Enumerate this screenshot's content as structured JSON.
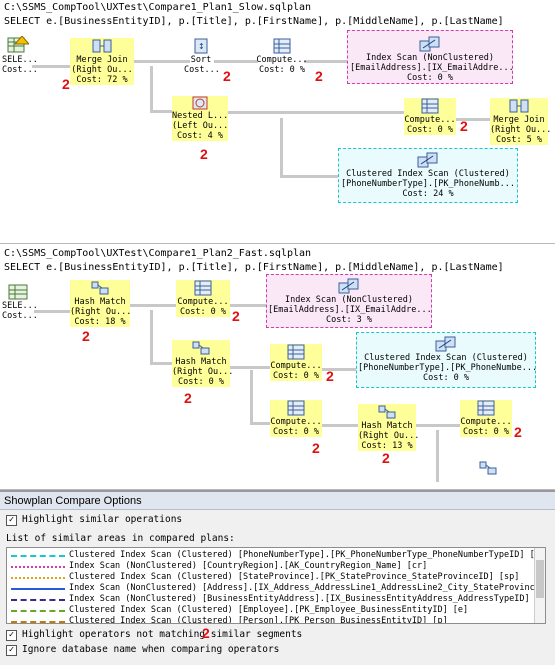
{
  "plan1": {
    "path": "C:\\SSMS_CompTool\\UXTest\\Compare1_Plan1_Slow.sqlplan",
    "query": "SELECT e.[BusinessEntityID], p.[Title], p.[FirstName], p.[MiddleName], p.[LastName]",
    "nodes": {
      "select": [
        "SELE...",
        "Cost..."
      ],
      "merge_join": [
        "Merge Join",
        "(Right Ou...",
        "Cost: 72 %"
      ],
      "sort": [
        "Sort",
        "Cost..."
      ],
      "compute1": [
        "Compute...",
        "Cost: 0 %"
      ],
      "index_scan": [
        "Index Scan (NonClustered)",
        "[EmailAddress].[IX_EmailAddre...",
        "Cost: 0 %"
      ],
      "nested": [
        "Nested L...",
        "(Left Ou...",
        "Cost: 4 %"
      ],
      "compute2": [
        "Compute...",
        "Cost: 0 %"
      ],
      "merge_join2": [
        "Merge Join",
        "(Right Ou...",
        "Cost: 5 %"
      ],
      "clustered": [
        "Clustered Index Scan (Clustered)",
        "[PhoneNumberType].[PK_PhoneNumb...",
        "Cost: 24 %"
      ]
    }
  },
  "plan2": {
    "path": "C:\\SSMS_CompTool\\UXTest\\Compare1_Plan2_Fast.sqlplan",
    "query": "SELECT e.[BusinessEntityID], p.[Title], p.[FirstName], p.[MiddleName], p.[LastName]",
    "nodes": {
      "select": [
        "SELE...",
        "Cost..."
      ],
      "hash1": [
        "Hash Match",
        "(Right Ou...",
        "Cost: 18 %"
      ],
      "compute1": [
        "Compute...",
        "Cost: 0 %"
      ],
      "index_scan": [
        "Index Scan (NonClustered)",
        "[EmailAddress].[IX_EmailAddre...",
        "Cost: 3 %"
      ],
      "hash2": [
        "Hash Match",
        "(Right Ou...",
        "Cost: 0 %"
      ],
      "compute2": [
        "Compute...",
        "Cost: 0 %"
      ],
      "clustered": [
        "Clustered Index Scan (Clustered)",
        "[PhoneNumberType].[PK_PhoneNumbe...",
        "Cost: 0 %"
      ],
      "compute3": [
        "Compute...",
        "Cost: 0 %"
      ],
      "hash3": [
        "Hash Match",
        "(Right Ou...",
        "Cost: 13 %"
      ],
      "compute4": [
        "Compute...",
        "Cost: 0 %"
      ]
    }
  },
  "marker": "2",
  "options": {
    "title": "Showplan Compare Options",
    "highlight_similar": "Highlight similar operations",
    "list_label": "List of similar areas in compared plans:",
    "rows": [
      {
        "color": "#1cc6cf",
        "style": "dashed",
        "text": "Clustered Index Scan (Clustered) [PhoneNumberType].[PK_PhoneNumberType_PhoneNumberTypeID] [pnt]"
      },
      {
        "color": "#d23bb0",
        "style": "dotted",
        "text": "Index Scan (NonClustered) [CountryRegion].[AK_CountryRegion_Name] [cr]"
      },
      {
        "color": "#e0a020",
        "style": "dotted",
        "text": "Clustered Index Scan (Clustered) [StateProvince].[PK_StateProvince_StateProvinceID] [sp]"
      },
      {
        "color": "#2a5bd7",
        "style": "solid",
        "text": "Index Scan (NonClustered) [Address].[IX_Address_AddressLine1_AddressLine2_City_StateProvinceID_PostalCode] [a]"
      },
      {
        "color": "#3a2a8a",
        "style": "dashed",
        "text": "Index Scan (NonClustered) [BusinessEntityAddress].[IX_BusinessEntityAddress_AddressTypeID] [bea]"
      },
      {
        "color": "#6aa82a",
        "style": "dashed",
        "text": "Clustered Index Scan (Clustered) [Employee].[PK_Employee_BusinessEntityID] [e]"
      },
      {
        "color": "#c07a10",
        "style": "dashed",
        "text": "Clustered Index Scan (Clustered) [Person].[PK_Person_BusinessEntityID] [p]"
      }
    ],
    "highlight_not_matching": "Highlight operators not matching similar segments",
    "ignore_db": "Ignore database name when comparing operators"
  }
}
